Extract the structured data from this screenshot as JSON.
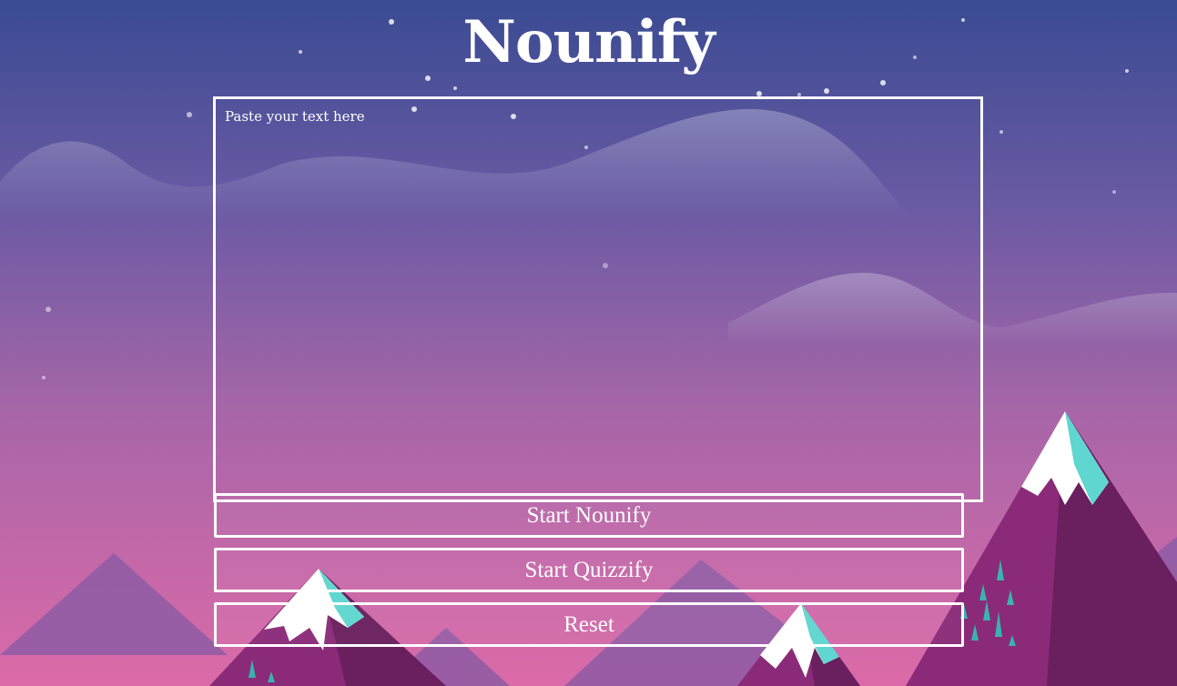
{
  "app": {
    "title": "Nounify"
  },
  "editor": {
    "placeholder": "Paste your text here",
    "value": ""
  },
  "actions": {
    "start_nounify": "Start Nounify",
    "start_quizzify": "Start Quizzify",
    "reset": "Reset"
  },
  "theme": {
    "sky_top": "#3d4f94",
    "sky_mid": "#8a5fa6",
    "sky_bottom": "#d968a6",
    "mountain_dark": "#6a1f62",
    "mountain_light": "#8a3a80",
    "snow": "#ffffff",
    "snow_shade": "#5fd6d0",
    "text": "#ffffff"
  }
}
